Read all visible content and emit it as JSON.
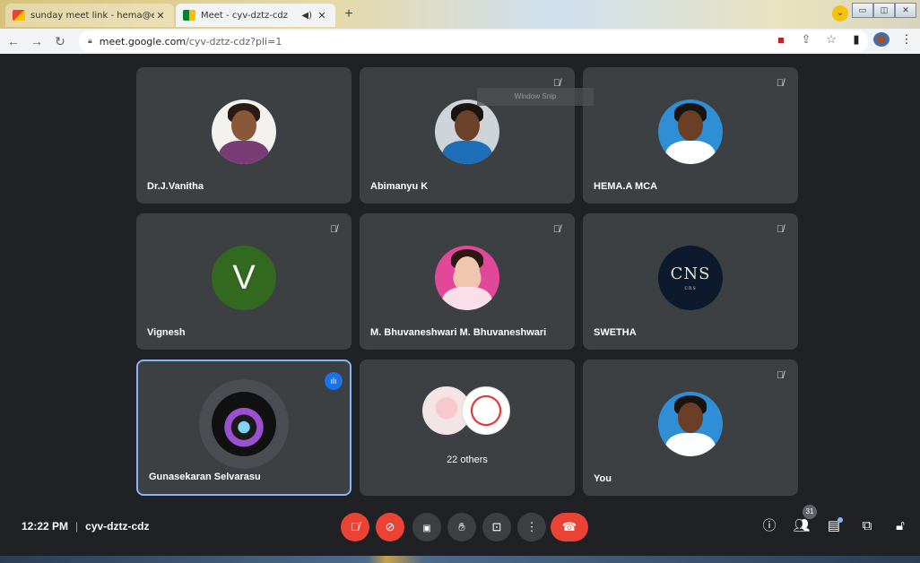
{
  "browser": {
    "tabs": [
      {
        "title": "sunday meet link - hema@egspe",
        "favicon": "gmail-icon",
        "active": false
      },
      {
        "title": "Meet - cyv-dztz-cdz",
        "favicon": "meet-icon",
        "active": true
      }
    ],
    "url_host": "meet.google.com",
    "url_path": "/cyv-dztz-cdz?pli=1"
  },
  "tooltip": "Window Snip",
  "tiles": [
    {
      "name": "Dr.J.Vanitha",
      "muted": false,
      "avatar": "photo"
    },
    {
      "name": "Abimanyu K",
      "muted": true,
      "avatar": "photo"
    },
    {
      "name": "HEMA.A MCA",
      "muted": true,
      "avatar": "photo"
    },
    {
      "name": "Vignesh",
      "muted": true,
      "avatar": "V"
    },
    {
      "name": "M. Bhuvaneshwari M. Bhuvaneshwari",
      "muted": true,
      "avatar": "photo"
    },
    {
      "name": "SWETHA",
      "muted": true,
      "avatar": "logo"
    },
    {
      "name": "Gunasekaran Selvarasu",
      "speaking": true,
      "avatar": "logo"
    },
    {
      "others_label": "22 others"
    },
    {
      "name": "You",
      "muted": true,
      "avatar": "photo"
    }
  ],
  "avatar_texts": {
    "vignesh": "V",
    "swetha_logo": "CNS",
    "swetha_sub": "cns"
  },
  "meeting": {
    "time": "12:22 PM",
    "separator": "|",
    "code": "cyv-dztz-cdz"
  },
  "participants_count": "31",
  "colors": {
    "background": "#202124",
    "tile": "#3c4043",
    "red_control": "#ea4335",
    "speaking_border": "#8ab4f8",
    "speaking_badge": "#1a73e8"
  }
}
